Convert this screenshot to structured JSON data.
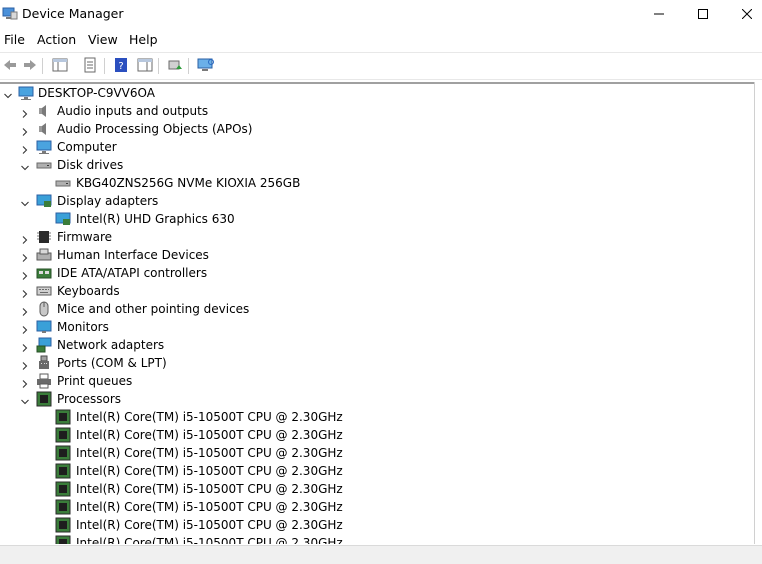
{
  "window": {
    "title": "Device Manager",
    "icon": "device-manager-icon",
    "controls": [
      "minimize-icon",
      "maximize-icon",
      "close-icon"
    ]
  },
  "menu": {
    "file": "File",
    "action": "Action",
    "view": "View",
    "help": "Help"
  },
  "toolbar": {
    "buttons": [
      "back-icon",
      "forward-icon",
      "show-hide-console-tree-icon",
      "properties-icon",
      "help-icon",
      "show-hide-action-pane-icon",
      "update-driver-icon",
      "scan-for-hardware-changes-icon"
    ]
  },
  "tree": {
    "root": "DESKTOP-C9VV6OA",
    "audio_io": "Audio inputs and outputs",
    "apo": "Audio Processing Objects (APOs)",
    "computer": "Computer",
    "disk_drives": "Disk drives",
    "disk_1": "KBG40ZNS256G NVMe KIOXIA 256GB",
    "display_adapters": "Display adapters",
    "display_1": "Intel(R) UHD Graphics 630",
    "firmware": "Firmware",
    "hid": "Human Interface Devices",
    "ide": "IDE ATA/ATAPI controllers",
    "keyboards": "Keyboards",
    "mice": "Mice and other pointing devices",
    "monitors": "Monitors",
    "network": "Network adapters",
    "ports": "Ports (COM & LPT)",
    "print_queues": "Print queues",
    "processors": "Processors",
    "cpu": "Intel(R) Core(TM) i5-10500T CPU @ 2.30GHz"
  },
  "colors": {
    "accent": "#2b6cc4",
    "chip": "#3a7d3a"
  }
}
